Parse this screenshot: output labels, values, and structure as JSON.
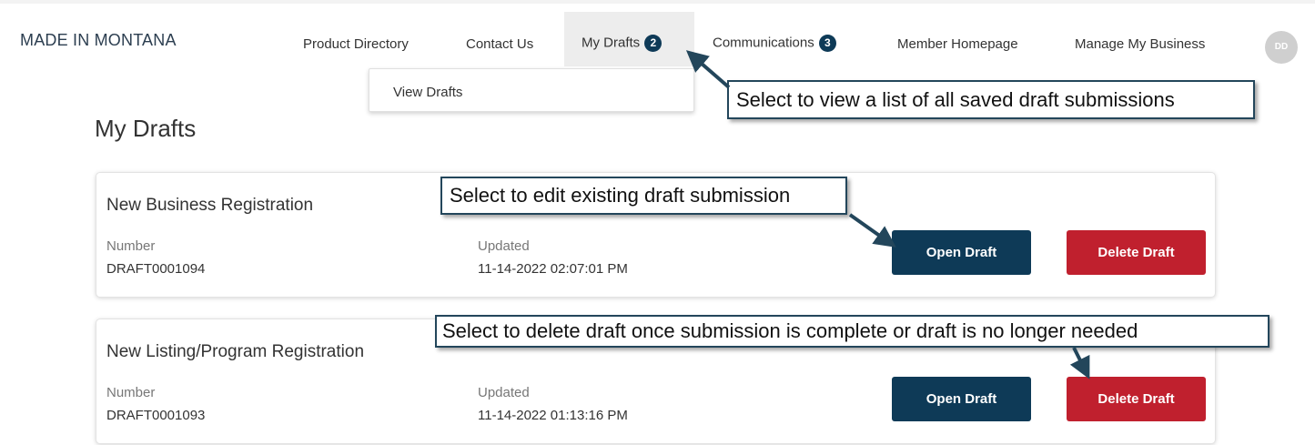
{
  "brand": "MADE IN MONTANA",
  "nav": {
    "product_directory": "Product Directory",
    "contact_us": "Contact Us",
    "my_drafts": "My Drafts",
    "my_drafts_badge": "2",
    "communications": "Communications",
    "communications_badge": "3",
    "member_homepage": "Member Homepage",
    "manage_my_business": "Manage My Business",
    "avatar_initials": "DD"
  },
  "dropdown": {
    "view_drafts": "View Drafts"
  },
  "page": {
    "title": "My Drafts"
  },
  "drafts": [
    {
      "title": "New Business Registration",
      "number_label": "Number",
      "number": "DRAFT0001094",
      "updated_label": "Updated",
      "updated": "11-14-2022 02:07:01 PM",
      "open_label": "Open Draft",
      "delete_label": "Delete Draft"
    },
    {
      "title": "New Listing/Program Registration",
      "number_label": "Number",
      "number": "DRAFT0001093",
      "updated_label": "Updated",
      "updated": "11-14-2022 01:13:16 PM",
      "open_label": "Open Draft",
      "delete_label": "Delete Draft"
    }
  ],
  "callouts": {
    "view_drafts": "Select to view a list of all saved draft submissions",
    "edit_draft": "Select to edit existing draft submission",
    "delete_draft": "Select to delete draft once submission is complete or draft is no longer needed"
  },
  "colors": {
    "primary": "#0e3a57",
    "danger": "#c0202e",
    "callout_border": "#23465b",
    "active_nav_bg": "#ededed"
  }
}
